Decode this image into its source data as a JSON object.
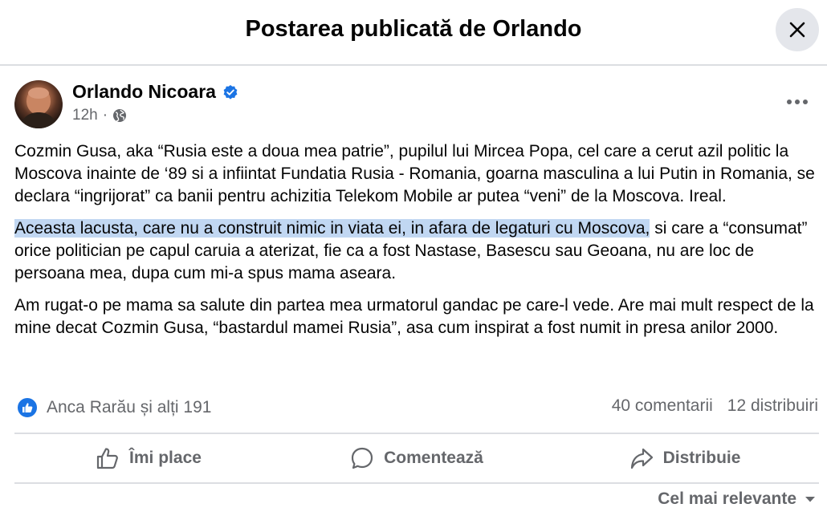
{
  "header": {
    "title": "Postarea publicată de Orlando"
  },
  "post": {
    "author": "Orlando Nicoara",
    "time": "12h",
    "dot": "·",
    "paragraphs": {
      "p1": "Cozmin Gusa, aka “Rusia este a doua mea patrie”, pupilul lui Mircea Popa, cel care a cerut azil politic la Moscova inainte de ‘89 si a infiintat Fundatia Rusia - Romania, goarna masculina a lui Putin in Romania, se declara “ingrijorat” ca banii pentru achizitia Telekom Mobile ar putea “veni” de la Moscova. Ireal.",
      "p2_highlight": "Aceasta lacusta, care nu a construit nimic in viata ei, in afara de legaturi cu Moscova,",
      "p2_rest": " si care a “consumat” orice politician pe capul caruia a aterizat, fie ca a fost Nastase, Basescu sau Geoana, nu are loc de persoana mea, dupa cum mi-a spus mama aseara.",
      "p3": "Am rugat-o pe mama sa salute din partea mea urmatorul gandac pe care-l vede. Are mai mult respect de la mine decat Cozmin Gusa, “bastardul mamei Rusia”, asa cum inspirat a fost numit in presa anilor 2000."
    }
  },
  "stats": {
    "reactions": "Anca Rarău și alți 191",
    "comments": "40 comentarii",
    "shares": "12 distribuiri"
  },
  "actions": {
    "like": "Îmi place",
    "comment": "Comentează",
    "share": "Distribuie"
  },
  "sort": {
    "label": "Cel mai relevante"
  },
  "colors": {
    "accent": "#1b74e4",
    "highlight": "#c1d7f2",
    "muted": "#65676b"
  },
  "icons": [
    "close-icon",
    "verified-badge-icon",
    "globe-icon",
    "more-options-icon",
    "like-reaction-icon",
    "thumbs-up-icon",
    "comment-icon",
    "share-icon",
    "caret-down-icon"
  ]
}
